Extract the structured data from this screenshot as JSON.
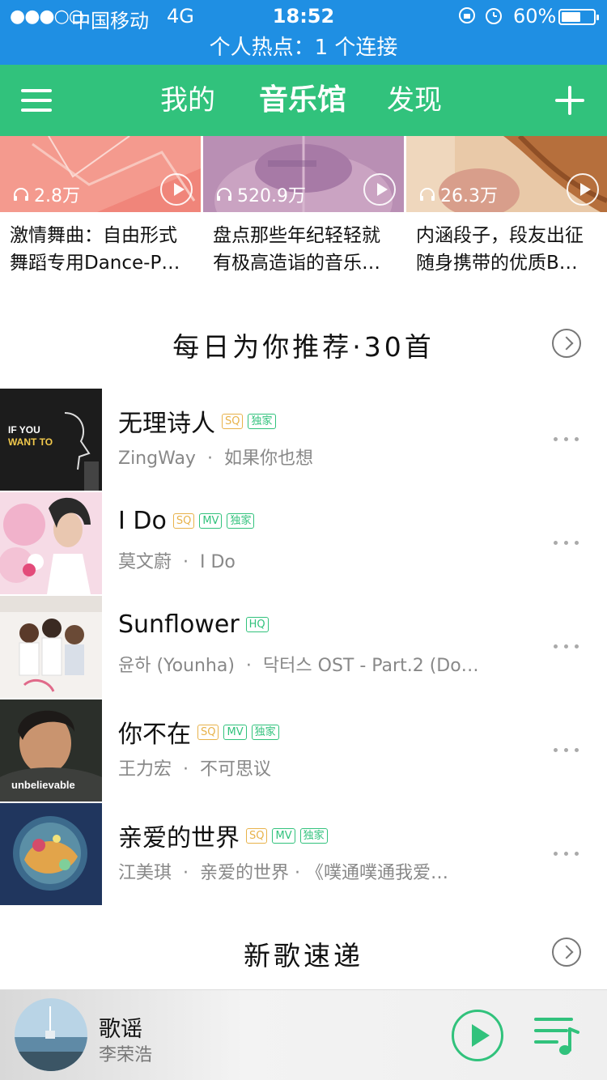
{
  "status_bar": {
    "signal": "●●●○○",
    "carrier": "中国移动",
    "network": "4G",
    "time": "18:52",
    "battery": "60%",
    "battery_level": 0.6,
    "hotspot": "个人热点：1 个连接"
  },
  "nav": {
    "tabs": [
      {
        "label": "我的"
      },
      {
        "label": "音乐馆"
      },
      {
        "label": "发现"
      }
    ],
    "active_tab": "音乐馆"
  },
  "playlists": [
    {
      "count": "2.8万",
      "title": "激情舞曲：自由形式舞蹈专用Dance-P…"
    },
    {
      "count": "520.9万",
      "title": "盘点那些年纪轻轻就有极高造诣的音乐…"
    },
    {
      "count": "26.3万",
      "title": "内涵段子，段友出征随身携带的优质B…"
    }
  ],
  "daily": {
    "title": "每日为你推荐·30首",
    "songs": [
      {
        "title": "无理诗人",
        "tags": [
          "SQ",
          "独家"
        ],
        "artist": "ZingWay",
        "album": "如果你也想"
      },
      {
        "title": "I Do",
        "tags": [
          "SQ",
          "MV",
          "独家"
        ],
        "artist": "莫文蔚",
        "album": "I Do"
      },
      {
        "title": "Sunflower",
        "tags": [
          "HQ"
        ],
        "artist": "윤하 (Younha)",
        "album": "닥터스 OST - Part.2 (Do…"
      },
      {
        "title": "你不在",
        "tags": [
          "SQ",
          "MV",
          "独家"
        ],
        "artist": "王力宏",
        "album": "不可思议"
      },
      {
        "title": "亲爱的世界",
        "tags": [
          "SQ",
          "MV",
          "独家"
        ],
        "artist": "江美琪",
        "album": "亲爱的世界 · 《噗通噗通我爱…"
      }
    ]
  },
  "new_songs": {
    "title": "新歌速递"
  },
  "player": {
    "title": "歌谣",
    "artist": "李荣浩"
  },
  "colors": {
    "status_blue": "#1f8fe3",
    "brand_green": "#31c27c",
    "sq_gold": "#e8b24a"
  },
  "icons": [
    "menu-icon",
    "plus-icon",
    "headphone-icon",
    "play-icon",
    "chevron-right-icon",
    "more-dots-icon",
    "queue-music-icon"
  ]
}
